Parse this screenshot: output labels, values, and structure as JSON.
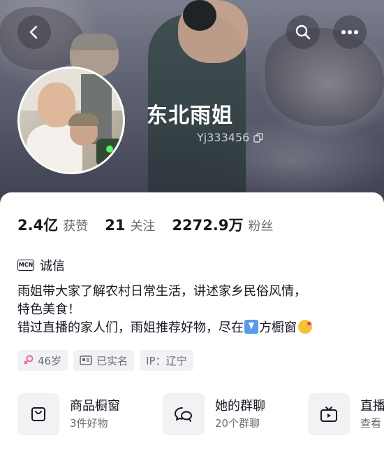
{
  "header": {
    "nickname": "东北雨姐",
    "user_id": "Yj333456",
    "icons": {
      "back": "chevron-left-icon",
      "search": "search-icon",
      "more": "more-icon",
      "copy": "copy-icon"
    }
  },
  "stats": [
    {
      "value": "2.4亿",
      "label": "获赞"
    },
    {
      "value": "21",
      "label": "关注"
    },
    {
      "value": "2272.9万",
      "label": "粉丝"
    }
  ],
  "certification": {
    "badge": "MCN",
    "label": "诚信"
  },
  "bio": {
    "line1": "雨姐带大家了解农村日常生活，讲述家乡民俗风情，",
    "line2": "特色美食！",
    "line3_a": "错过直播的家人们，雨姐推荐好物，尽在",
    "line3_b": "方橱窗"
  },
  "tags": [
    {
      "icon": "female-icon",
      "label": "46岁"
    },
    {
      "icon": "id-card-icon",
      "label": "已实名"
    },
    {
      "icon": "",
      "label": "IP：辽宁"
    }
  ],
  "entries": [
    {
      "icon": "shopping-bag-icon",
      "title": "商品橱窗",
      "subtitle": "3件好物"
    },
    {
      "icon": "group-chat-icon",
      "title": "她的群聊",
      "subtitle": "20个群聊"
    },
    {
      "icon": "tv-icon",
      "title": "直播",
      "subtitle": "查看"
    }
  ],
  "colors": {
    "background": "#ffffff",
    "text": "#161823",
    "secondary_text": "#6a6b73",
    "chip_bg": "#f2f2f4",
    "female_pink": "#f3549b"
  }
}
